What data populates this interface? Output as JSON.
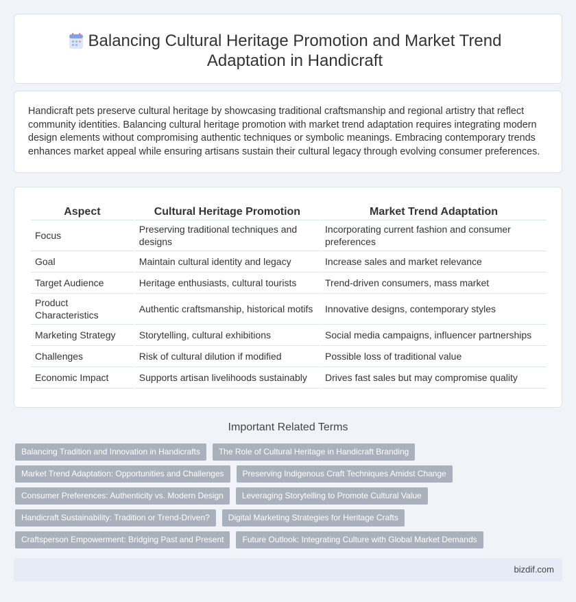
{
  "header": {
    "icon": "document-list-icon",
    "title": "Balancing Cultural Heritage Promotion and Market Trend Adaptation in Handicraft"
  },
  "intro": "Handicraft pets preserve cultural heritage by showcasing traditional craftsmanship and regional artistry that reflect community identities. Balancing cultural heritage promotion with market trend adaptation requires integrating modern design elements without compromising authentic techniques or symbolic meanings. Embracing contemporary trends enhances market appeal while ensuring artisans sustain their cultural legacy through evolving consumer preferences.",
  "table": {
    "headers": [
      "Aspect",
      "Cultural Heritage Promotion",
      "Market Trend Adaptation"
    ],
    "rows": [
      [
        "Focus",
        "Preserving traditional techniques and designs",
        "Incorporating current fashion and consumer preferences"
      ],
      [
        "Goal",
        "Maintain cultural identity and legacy",
        "Increase sales and market relevance"
      ],
      [
        "Target Audience",
        "Heritage enthusiasts, cultural tourists",
        "Trend-driven consumers, mass market"
      ],
      [
        "Product Characteristics",
        "Authentic craftsmanship, historical motifs",
        "Innovative designs, contemporary styles"
      ],
      [
        "Marketing Strategy",
        "Storytelling, cultural exhibitions",
        "Social media campaigns, influencer partnerships"
      ],
      [
        "Challenges",
        "Risk of cultural dilution if modified",
        "Possible loss of traditional value"
      ],
      [
        "Economic Impact",
        "Supports artisan livelihoods sustainably",
        "Drives fast sales but may compromise quality"
      ]
    ]
  },
  "related": {
    "title": "Important Related Terms",
    "tags": [
      "Balancing Tradition and Innovation in Handicrafts",
      "The Role of Cultural Heritage in Handicraft Branding",
      "Market Trend Adaptation: Opportunities and Challenges",
      "Preserving Indigenous Craft Techniques Amidst Change",
      "Consumer Preferences: Authenticity vs. Modern Design",
      "Leveraging Storytelling to Promote Cultural Value",
      "Handicraft Sustainability: Tradition or Trend-Driven?",
      "Digital Marketing Strategies for Heritage Crafts",
      "Craftsperson Empowerment: Bridging Past and Present",
      "Future Outlook: Integrating Culture with Global Market Demands"
    ]
  },
  "footer": {
    "brand": "bizdif.com"
  },
  "colors": {
    "background": "#f0f3f8",
    "tag": "#aab1bd",
    "footer": "#e6ebf5"
  }
}
